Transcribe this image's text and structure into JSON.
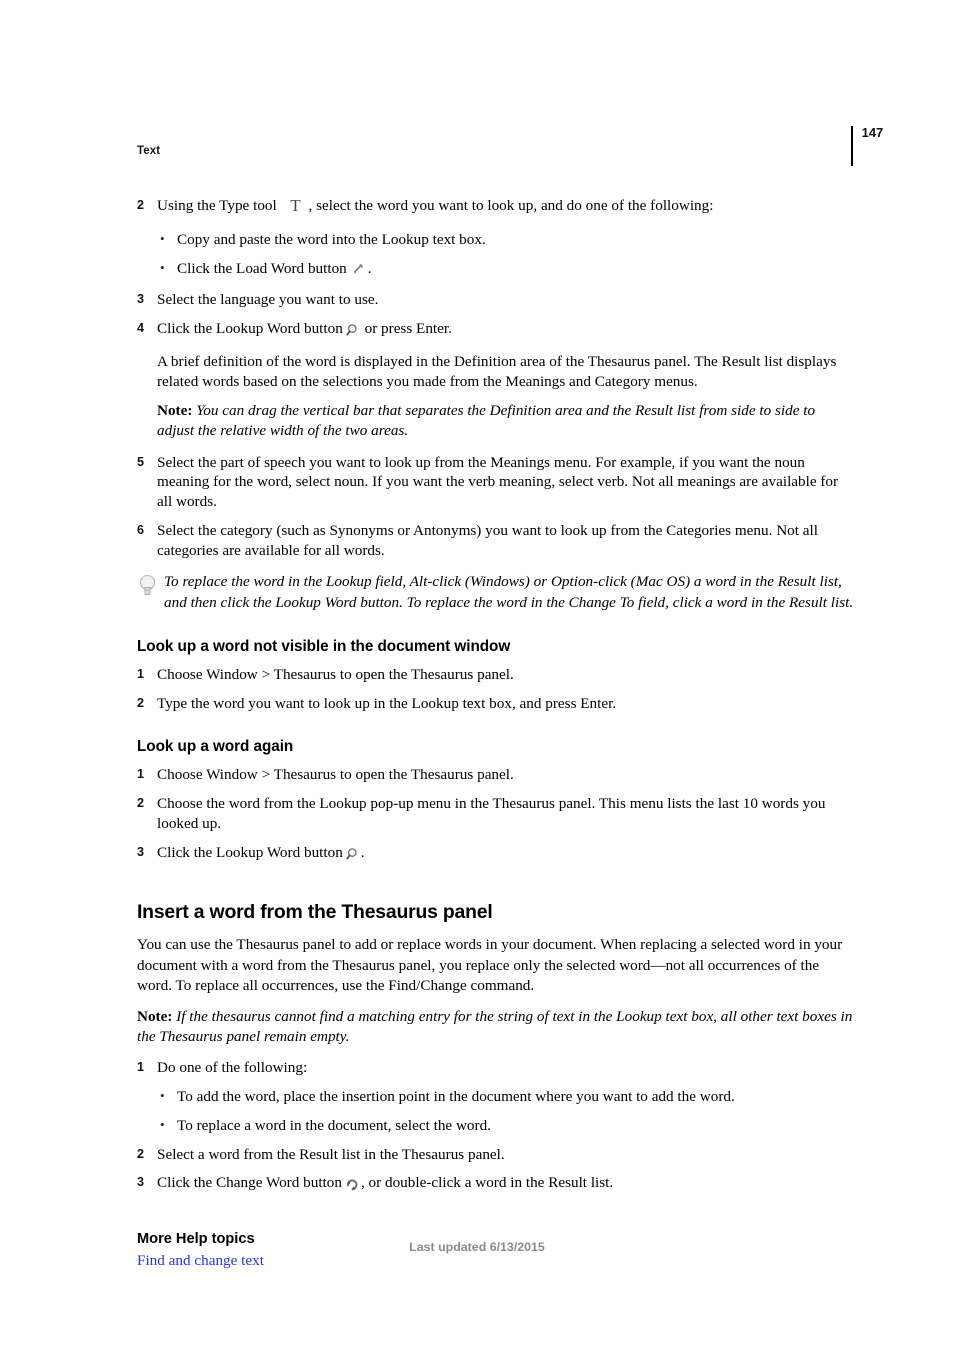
{
  "header": {
    "running_head": "Text",
    "page_number": "147"
  },
  "icons": {
    "type_tool": "type-tool-icon",
    "load_word": "load-word-icon",
    "lookup_word": "lookup-word-magnifier-icon",
    "change_word": "change-word-icon",
    "tip_bulb": "lightbulb-icon"
  },
  "steps_top": [
    {
      "num": "2",
      "text_before_icon": "Using the Type tool",
      "text_after_icon": ", select the word you want to look up, and do one of the following:",
      "bullets": [
        {
          "text_before_icon": "Copy and paste the word into the Lookup text box.",
          "text_after_icon": ""
        },
        {
          "text_before_icon": "Click the Load Word button",
          "text_after_icon": "."
        }
      ]
    },
    {
      "num": "3",
      "text_before_icon": "Select the language you want to use.",
      "text_after_icon": ""
    },
    {
      "num": "4",
      "text_before_icon": "Click the Lookup Word button",
      "text_after_icon": "or press Enter."
    }
  ],
  "step4_para": "A brief definition of the word is displayed in the Definition area of the Thesaurus panel. The Result list displays related words based on the selections you made from the Meanings and Category menus.",
  "note_1": {
    "label": "Note:",
    "text": " You can drag the vertical bar that separates the Definition area and the Result list from side to side to adjust the relative width of the two areas."
  },
  "steps_mid": [
    {
      "num": "5",
      "text": "Select the part of speech you want to look up from the Meanings menu. For example, if you want the noun meaning for the word, select noun. If you want the verb meaning, select verb. Not all meanings are available for all words."
    },
    {
      "num": "6",
      "text": "Select the category (such as Synonyms or Antonyms) you want to look up from the Categories menu. Not all categories are available for all words."
    }
  ],
  "tip": "To replace the word in the Lookup field, Alt-click (Windows) or Option-click (Mac OS) a word in the Result list, and then click the Lookup Word button. To replace the word in the Change To field, click a word in the Result list.",
  "section_lookup_not_visible": {
    "heading": "Look up a word not visible in the document window",
    "steps": [
      {
        "num": "1",
        "text": "Choose Window > Thesaurus to open the Thesaurus panel."
      },
      {
        "num": "2",
        "text": "Type the word you want to look up in the Lookup text box, and press Enter."
      }
    ]
  },
  "section_lookup_again": {
    "heading": "Look up a word again",
    "steps": [
      {
        "num": "1",
        "text_before_icon": "Choose Window > Thesaurus to open the Thesaurus panel.",
        "text_after_icon": ""
      },
      {
        "num": "2",
        "text_before_icon": "Choose the word from the Lookup pop-up menu in the Thesaurus panel. This menu lists the last 10 words you looked up.",
        "text_after_icon": ""
      },
      {
        "num": "3",
        "text_before_icon": "Click the Lookup Word button",
        "text_after_icon": "."
      }
    ]
  },
  "section_insert_word": {
    "heading": "Insert a word from the Thesaurus panel",
    "intro": "You can use the Thesaurus panel to add or replace words in your document. When replacing a selected word in your document with a word from the Thesaurus panel, you replace only the selected word—not all occurrences of the word. To replace all occurrences, use the Find/Change command.",
    "note": {
      "label": "Note:",
      "text": " If the thesaurus cannot find a matching entry for the string of text in the Lookup text box, all other text boxes in the Thesaurus panel remain empty."
    },
    "steps": [
      {
        "num": "1",
        "text_before_icon": "Do one of the following:",
        "text_after_icon": "",
        "bullets": [
          "To add the word, place the insertion point in the document where you want to add the word.",
          "To replace a word in the document, select the word."
        ]
      },
      {
        "num": "2",
        "text_before_icon": "Select a word from the Result list in the Thesaurus panel.",
        "text_after_icon": ""
      },
      {
        "num": "3",
        "text_before_icon": "Click the Change Word button",
        "text_after_icon": ", or double-click a word in the Result list."
      }
    ]
  },
  "more_help": {
    "heading": "More Help topics",
    "link": "Find and change text",
    "link_color": "#2b35e8"
  },
  "footer": {
    "text": "Last updated 6/13/2015"
  }
}
